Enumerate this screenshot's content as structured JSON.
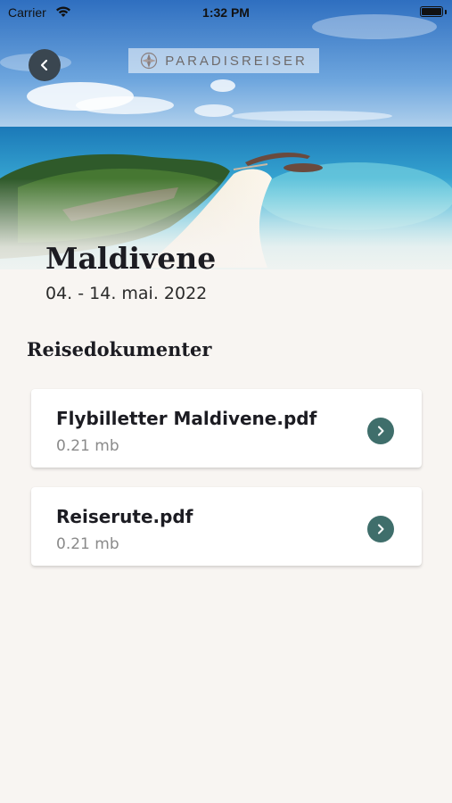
{
  "status_bar": {
    "carrier": "Carrier",
    "time": "1:32 PM"
  },
  "header": {
    "brand": "PARADISREISER",
    "back_icon": "chevron-left-icon",
    "logo_icon": "compass-rose-icon"
  },
  "trip": {
    "title": "Maldivene",
    "dates": "04. - 14. mai. 2022"
  },
  "documents_section": {
    "title": "Reisedokumenter",
    "items": [
      {
        "name": "Flybilletter Maldivene.pdf",
        "size": "0.21 mb",
        "icon": "chevron-right-icon"
      },
      {
        "name": "Reiserute.pdf",
        "size": "0.21 mb",
        "icon": "chevron-right-icon"
      }
    ]
  },
  "colors": {
    "background": "#f8f5f2",
    "accent": "#3f6e6b",
    "back_button": "#3a4650",
    "text": "#1c1c22",
    "muted": "#8a8a8a"
  }
}
